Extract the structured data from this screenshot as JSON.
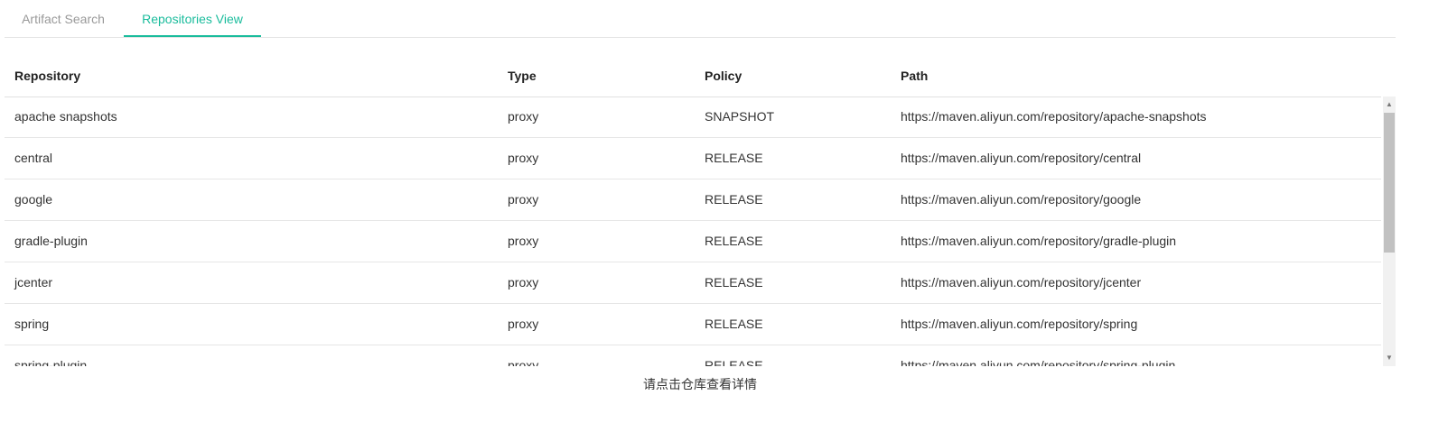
{
  "tabs": [
    {
      "label": "Artifact Search",
      "active": false
    },
    {
      "label": "Repositories View",
      "active": true
    }
  ],
  "table": {
    "columns": [
      "Repository",
      "Type",
      "Policy",
      "Path"
    ],
    "rows": [
      {
        "repository": "apache snapshots",
        "type": "proxy",
        "policy": "SNAPSHOT",
        "path": "https://maven.aliyun.com/repository/apache-snapshots"
      },
      {
        "repository": "central",
        "type": "proxy",
        "policy": "RELEASE",
        "path": "https://maven.aliyun.com/repository/central"
      },
      {
        "repository": "google",
        "type": "proxy",
        "policy": "RELEASE",
        "path": "https://maven.aliyun.com/repository/google"
      },
      {
        "repository": "gradle-plugin",
        "type": "proxy",
        "policy": "RELEASE",
        "path": "https://maven.aliyun.com/repository/gradle-plugin"
      },
      {
        "repository": "jcenter",
        "type": "proxy",
        "policy": "RELEASE",
        "path": "https://maven.aliyun.com/repository/jcenter"
      },
      {
        "repository": "spring",
        "type": "proxy",
        "policy": "RELEASE",
        "path": "https://maven.aliyun.com/repository/spring"
      },
      {
        "repository": "spring-plugin",
        "type": "proxy",
        "policy": "RELEASE",
        "path": "https://maven.aliyun.com/repository/spring-plugin"
      }
    ]
  },
  "scrollbar": {
    "up_icon": "triangle-up",
    "down_icon": "triangle-down"
  },
  "footer": {
    "hint": "请点击仓库查看详情"
  },
  "colors": {
    "accent": "#1abc9c",
    "border": "#e4e4e4"
  }
}
